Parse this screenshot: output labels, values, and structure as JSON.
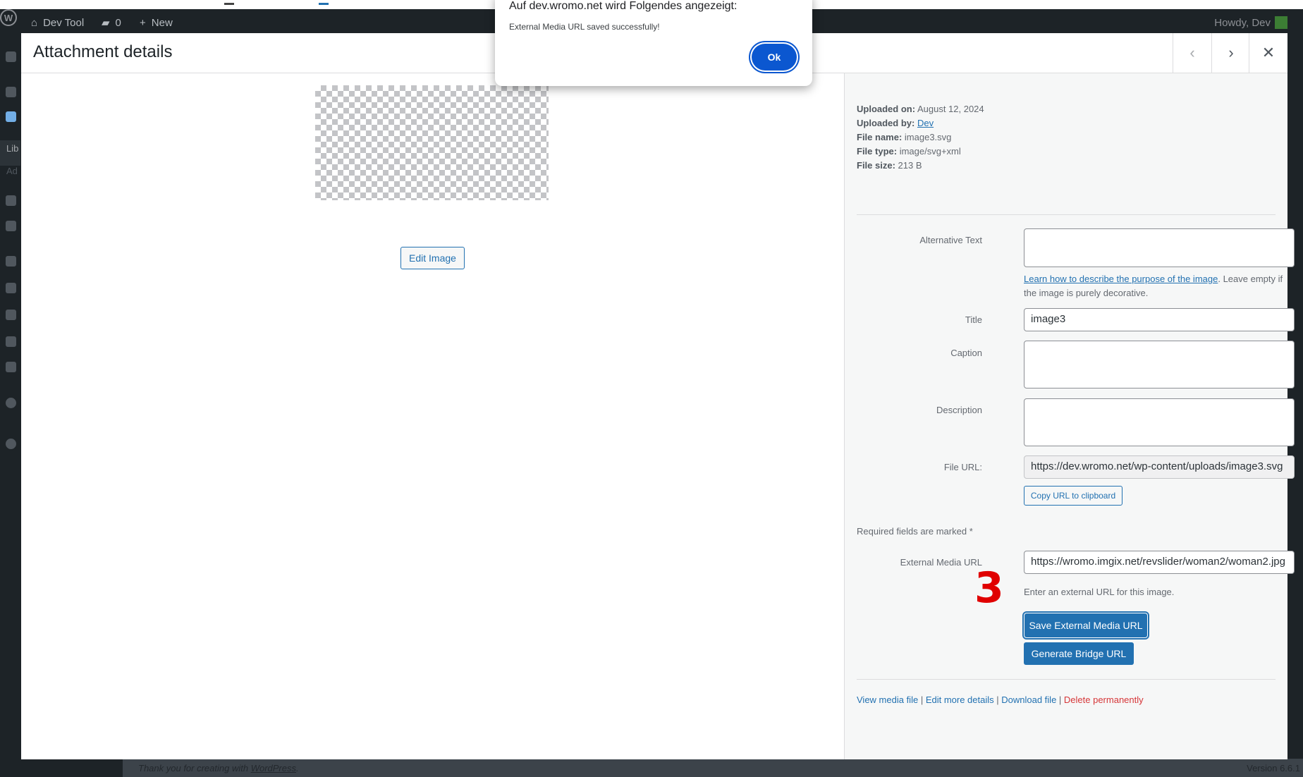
{
  "adminbar": {
    "site_name": "Dev Tool",
    "comments_count": "0",
    "new_label": "New",
    "howdy": "Howdy, Dev"
  },
  "adminmenu": {
    "lib_label": "Lib",
    "add_label": "Ad"
  },
  "footer": {
    "thanks_prefix": "Thank you for creating with ",
    "thanks_link": "WordPress",
    "thanks_suffix": ".",
    "version": "Version 6.6.1"
  },
  "modal": {
    "title": "Attachment details",
    "edit_image_label": "Edit Image"
  },
  "details": {
    "uploaded_on_label": "Uploaded on:",
    "uploaded_on": "August 12, 2024",
    "uploaded_by_label": "Uploaded by:",
    "uploaded_by": "Dev",
    "file_name_label": "File name:",
    "file_name": "image3.svg",
    "file_type_label": "File type:",
    "file_type": "image/svg+xml",
    "file_size_label": "File size:",
    "file_size": "213 B"
  },
  "form": {
    "alt_label": "Alternative Text",
    "alt_help_link": "Learn how to describe the purpose of the image",
    "alt_help_text": ". Leave empty if the image is purely decorative.",
    "title_label": "Title",
    "title_value": "image3",
    "caption_label": "Caption",
    "description_label": "Description",
    "file_url_label": "File URL:",
    "file_url_value": "https://dev.wromo.net/wp-content/uploads/image3.svg",
    "copy_url_label": "Copy URL to clipboard",
    "required_note": "Required fields are marked *",
    "external_url_label": "External Media URL",
    "external_url_value": "https://wromo.imgix.net/revslider/woman2/woman2.jpg",
    "external_help": "Enter an external URL for this image.",
    "save_external_label": "Save External Media URL",
    "generate_bridge_label": "Generate Bridge URL"
  },
  "step_marker": "3",
  "actions": {
    "view": "View media file",
    "edit_more": "Edit more details",
    "download": "Download file",
    "delete": "Delete permanently",
    "separator": " | "
  },
  "alert": {
    "title": "Auf dev.wromo.net wird Folgendes angezeigt:",
    "message": "External Media URL saved successfully!",
    "ok_label": "Ok"
  }
}
